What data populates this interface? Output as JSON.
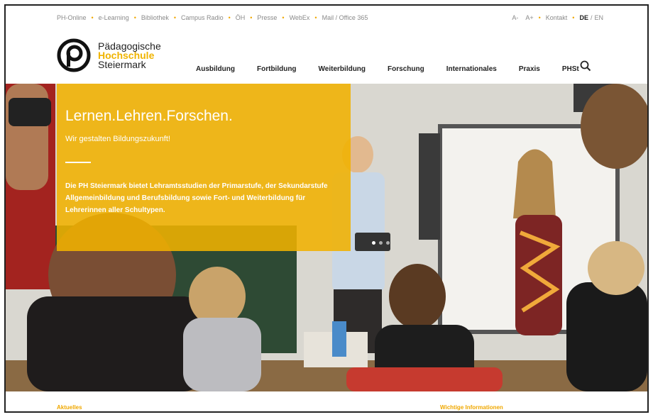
{
  "utility": {
    "left_links": [
      "PH-Online",
      "e-Learning",
      "Bibliothek",
      "Campus Radio",
      "ÖH",
      "Presse",
      "WebEx",
      "Mail / Office 365"
    ],
    "font_smaller": "A-",
    "font_larger": "A+",
    "contact": "Kontakt",
    "lang_de": "DE",
    "lang_en": "EN"
  },
  "logo": {
    "line1": "Pädagogische",
    "line2": "Hochschule",
    "line3": "Steiermark"
  },
  "nav": {
    "items": [
      "Ausbildung",
      "Fortbildung",
      "Weiterbildung",
      "Forschung",
      "Internationales",
      "Praxis",
      "PHSt"
    ],
    "search_icon": "search-icon"
  },
  "hero": {
    "title": "Lernen.Lehren.Forschen.",
    "subtitle": "Wir gestalten Bildungszukunft!",
    "body": "Die PH Steiermark bietet Lehramtsstudien der Primarstufe, der Sekundarstufe Allgemeinbildung und Berufsbildung sowie Fort- und Weiterbildung für Lehrerinnen aller Schultypen.",
    "slides_active": 1,
    "slides_total": 3
  },
  "sections": {
    "left": "Aktuelles",
    "right": "Wichtige Informationen"
  },
  "colors": {
    "accent": "#f0b200",
    "text": "#222222"
  }
}
